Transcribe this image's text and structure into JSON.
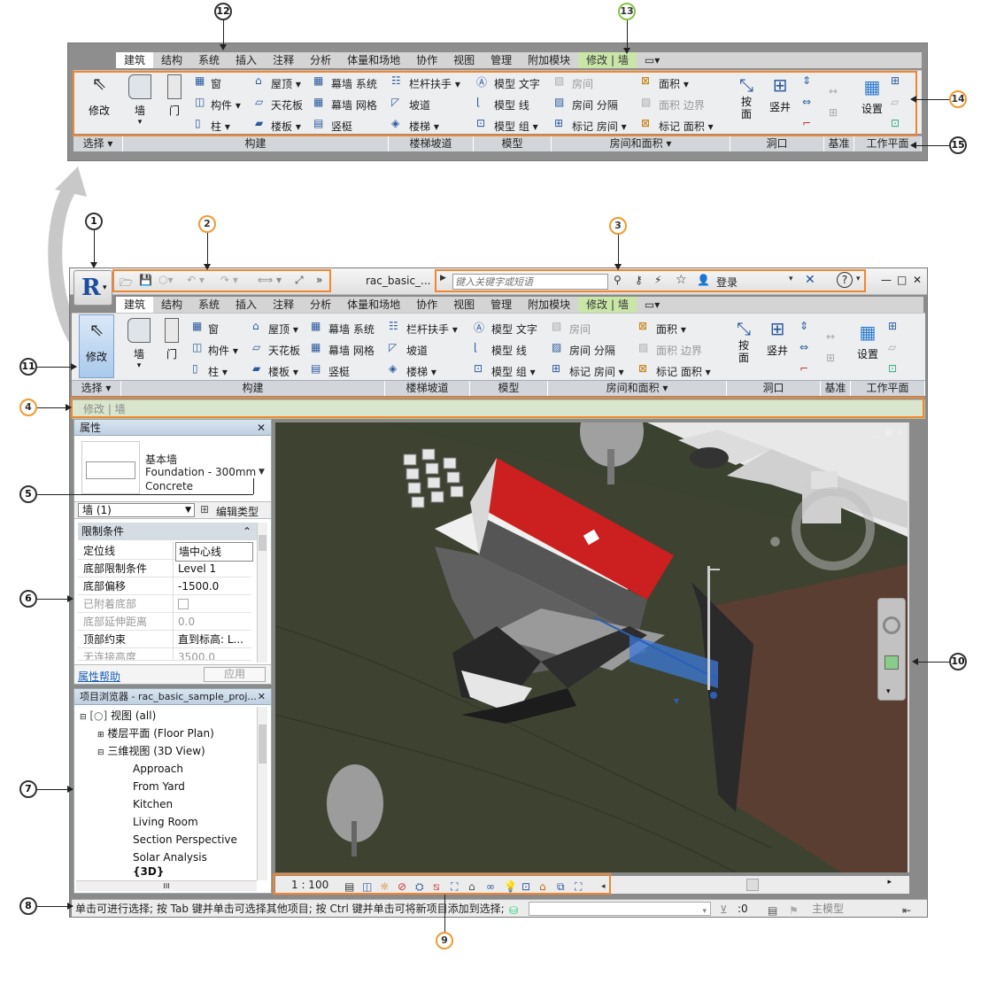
{
  "callouts": [
    "1",
    "2",
    "3",
    "4",
    "5",
    "6",
    "7",
    "8",
    "9",
    "10",
    "11",
    "12",
    "13",
    "14",
    "15"
  ],
  "colors": {
    "highlight": "#f2862e",
    "context_tab": "#86c440",
    "ribbon_bg": "#eceef0",
    "roof": "#cc1f1f"
  },
  "app": {
    "file_title": "rac_basic_...",
    "search_placeholder": "键入关键字或短语",
    "login_label": "登录",
    "help_label": "?",
    "minimize": "—",
    "maximize": "□",
    "close": "✕"
  },
  "ribbon": {
    "tabs": [
      "建筑",
      "结构",
      "系统",
      "插入",
      "注释",
      "分析",
      "体量和场地",
      "协作",
      "视图",
      "管理",
      "附加模块",
      "修改 | 墙"
    ],
    "modify_label": "修改",
    "build": {
      "wall": "墙",
      "door": "门",
      "window": "窗",
      "component": "构件",
      "column": "柱",
      "roof": "屋顶",
      "ceiling": "天花板",
      "floor": "楼板",
      "curtain_system": "幕墙 系统",
      "curtain_grid": "幕墙 网格",
      "mullion": "竖梃"
    },
    "circulation": {
      "railing": "栏杆扶手",
      "ramp": "坡道",
      "stair": "楼梯"
    },
    "model": {
      "text": "模型 文字",
      "line": "模型 线",
      "group": "模型 组"
    },
    "room_area": {
      "room": "房间",
      "room_separator": "房间 分隔",
      "tag_room": "标记 房间",
      "area": "面积",
      "area_boundary": "面积 边界",
      "tag_area": "标记 面积"
    },
    "opening": {
      "by_face": "按 面",
      "shaft": "竖井"
    },
    "workplane": {
      "set": "设置"
    },
    "panels": [
      "选择",
      "构建",
      "楼梯坡道",
      "模型",
      "房间和面积",
      "洞口",
      "基准",
      "工作平面"
    ]
  },
  "options_bar": {
    "text": "修改 | 墙"
  },
  "properties": {
    "title": "属性",
    "close": "✕",
    "type_family": "基本墙",
    "type_name": "Foundation - 300mm",
    "type_material": "Concrete",
    "selector": "墙 (1)",
    "edit_type": "编辑类型",
    "group": "限制条件",
    "rows": [
      {
        "k": "定位线",
        "v": "墙中心线"
      },
      {
        "k": "底部限制条件",
        "v": "Level 1"
      },
      {
        "k": "底部偏移",
        "v": "-1500.0"
      },
      {
        "k": "已附着底部",
        "v": ""
      },
      {
        "k": "底部延伸距离",
        "v": "0.0"
      },
      {
        "k": "顶部约束",
        "v": "直到标高: L..."
      },
      {
        "k": "无连接高度",
        "v": "3500.0"
      }
    ],
    "help": "属性帮助",
    "apply": "应用"
  },
  "browser": {
    "title": "项目浏览器 - rac_basic_sample_proj...",
    "close": "✕",
    "items": [
      "视图 (all)",
      "楼层平面 (Floor Plan)",
      "三维视图 (3D View)",
      "Approach",
      "From Yard",
      "Kitchen",
      "Living Room",
      "Section Perspective",
      "Solar Analysis",
      "{3D}"
    ],
    "scroll_mark": "III"
  },
  "view_control": {
    "scale": "1 : 100"
  },
  "status": {
    "text": "单击可进行选择; 按 Tab 键并单击可选择其他项目; 按 Ctrl 键并单击可将新项目添加到选择;",
    "count": ":0",
    "model": "主模型"
  }
}
